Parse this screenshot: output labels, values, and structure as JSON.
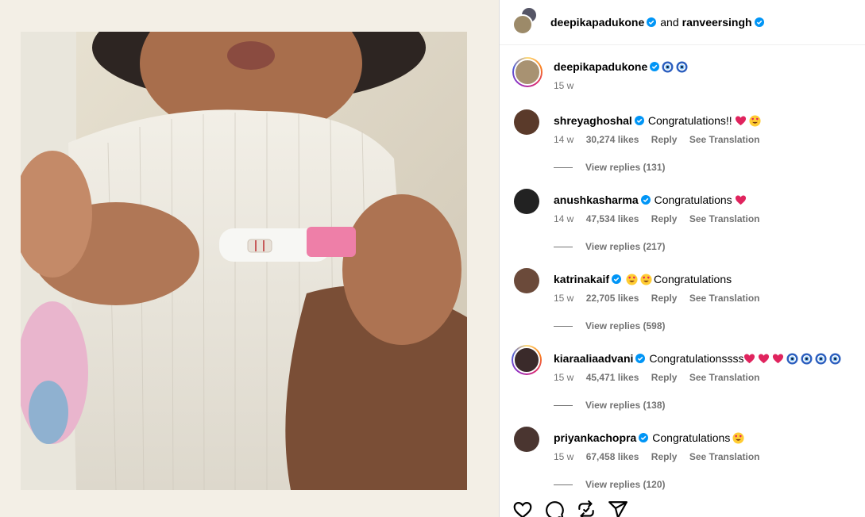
{
  "header": {
    "user1": "deepikapadukone",
    "connector": "and",
    "user2": "ranveersingh"
  },
  "caption": {
    "username": "deepikapadukone",
    "emojis": [
      "nazar-amulet",
      "nazar-amulet"
    ],
    "time": "15 w"
  },
  "comments": [
    {
      "username": "shreyaghoshal",
      "text": "Congratulations!!",
      "emojis": [
        "heart",
        "heart-eyes"
      ],
      "time": "14 w",
      "likes": "30,274 likes",
      "reply": "Reply",
      "translate": "See Translation",
      "replies": "View replies (131)"
    },
    {
      "username": "anushkasharma",
      "text": "Congratulations",
      "emojis": [
        "heart"
      ],
      "time": "14 w",
      "likes": "47,534 likes",
      "reply": "Reply",
      "translate": "See Translation",
      "replies": "View replies (217)"
    },
    {
      "username": "katrinakaif",
      "text": "Congratulations",
      "emojis_before": [
        "heart-eyes",
        "heart-eyes"
      ],
      "time": "15 w",
      "likes": "22,705 likes",
      "reply": "Reply",
      "translate": "See Translation",
      "replies": "View replies (598)"
    },
    {
      "username": "kiaraaliaadvani",
      "text": "Congratulationssss",
      "emojis": [
        "heart",
        "heart",
        "heart",
        "nazar-amulet",
        "nazar-amulet",
        "nazar-amulet",
        "nazar-amulet"
      ],
      "time": "15 w",
      "likes": "45,471 likes",
      "reply": "Reply",
      "translate": "See Translation",
      "replies": "View replies (138)"
    },
    {
      "username": "priyankachopra",
      "text": "Congratulations",
      "emojis": [
        "heart-eyes"
      ],
      "time": "15 w",
      "likes": "67,458 likes",
      "reply": "Reply",
      "translate": "See Translation",
      "replies": "View replies (120)"
    }
  ],
  "actions": [
    "like-icon",
    "comment-icon",
    "repost-icon",
    "share-icon"
  ],
  "colors": {
    "verified": "#0095f6",
    "muted": "#737373",
    "heart": "#e0245e"
  }
}
